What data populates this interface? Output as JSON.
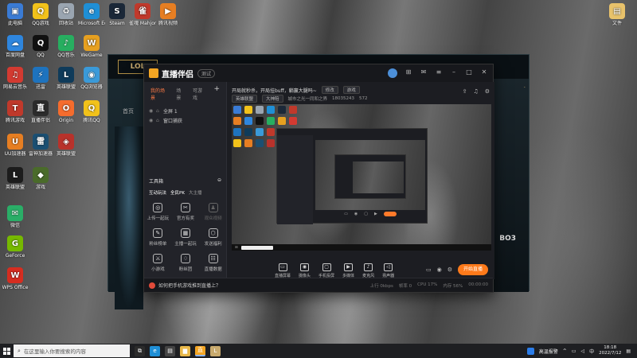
{
  "desktop": {
    "icons": [
      {
        "label": "此电脑",
        "color": "#3a7bd5",
        "glyph": "▣"
      },
      {
        "label": "QQ游戏",
        "color": "#f2c21a",
        "glyph": "Q"
      },
      {
        "label": "回收站",
        "color": "#9aa5b1",
        "glyph": "♻"
      },
      {
        "label": "Microsoft Edge",
        "color": "#1f8fd6",
        "glyph": "e"
      },
      {
        "label": "Steam",
        "color": "#1b2838",
        "glyph": "S"
      },
      {
        "label": "雀魂 Mahjong",
        "color": "#c0392b",
        "glyph": "雀"
      },
      {
        "label": "腾讯视频",
        "color": "#e67e22",
        "glyph": "▶"
      },
      {
        "label": "百度网盘",
        "color": "#2e86de",
        "glyph": "☁"
      },
      {
        "label": "QQ",
        "color": "#111",
        "glyph": "Q"
      },
      {
        "label": "QQ音乐",
        "color": "#27ae60",
        "glyph": "♪"
      },
      {
        "label": "WeGame",
        "color": "#e6a020",
        "glyph": "W"
      },
      {
        "label": "网易云音乐",
        "color": "#d33a31",
        "glyph": "♫"
      },
      {
        "label": "迅雷",
        "color": "#1e73be",
        "glyph": "⚡"
      },
      {
        "label": "英雄联盟",
        "color": "#0f3b5a",
        "glyph": "L"
      },
      {
        "label": "QQ浏览器",
        "color": "#3a9ad9",
        "glyph": "◉"
      },
      {
        "label": "腾讯游戏",
        "color": "#c0392b",
        "glyph": "T"
      },
      {
        "label": "直播伴侣",
        "color": "#2b2b2b",
        "glyph": "直"
      },
      {
        "label": "Origin",
        "color": "#f56c2d",
        "glyph": "O"
      },
      {
        "label": "腾讯QQ",
        "color": "#f2c21a",
        "glyph": "Q"
      },
      {
        "label": "UU加速器",
        "color": "#e67e22",
        "glyph": "U"
      },
      {
        "label": "雷神加速器",
        "color": "#1b4f72",
        "glyph": "雷"
      },
      {
        "label": "英雄联盟",
        "color": "#b8322b",
        "glyph": "◈"
      },
      {
        "label": "英雄联盟",
        "color": "#1c1c1c",
        "glyph": "L"
      },
      {
        "label": "游戏",
        "color": "#4a6b2a",
        "glyph": "◆"
      },
      {
        "label": "微信",
        "color": "#2aae67",
        "glyph": "✉"
      },
      {
        "label": "GeForce",
        "color": "#76b900",
        "glyph": "G"
      },
      {
        "label": "WPS Office",
        "color": "#d62d20",
        "glyph": "W"
      },
      {
        "label": "文件",
        "color": "#e8c26b",
        "glyph": "▤"
      }
    ]
  },
  "game_window": {
    "logo": "LOL",
    "side_label": "首页",
    "right_text": "·",
    "bo3": "BO3"
  },
  "app": {
    "name": "直播伴侣",
    "version": "测试",
    "tabs": [
      "我的场景",
      "场景",
      "可游戏"
    ],
    "scenes": [
      "全屏 1",
      "窗口捕获"
    ],
    "toolbox_title": "工具箱",
    "toolbox_tabs": [
      "互动玩法",
      "全民PK",
      "大主播"
    ],
    "tools": [
      {
        "label": "上传一起玩",
        "icon": "◎",
        "dim": false
      },
      {
        "label": "官方有奖",
        "icon": "✂",
        "dim": false
      },
      {
        "label": "观众视频",
        "icon": "♟",
        "dim": true
      },
      {
        "label": "粉丝榜单",
        "icon": "✎",
        "dim": false
      },
      {
        "label": "主播一起玩",
        "icon": "▦",
        "dim": false
      },
      {
        "label": "发送福利",
        "icon": "⬡",
        "dim": false
      },
      {
        "label": "小游戏",
        "icon": "⚔",
        "dim": false
      },
      {
        "label": "粉丝团",
        "icon": "♢",
        "dim": false
      },
      {
        "label": "直播数据",
        "icon": "☷",
        "dim": false
      }
    ],
    "stream_title": "开局就秒杀，开局挂buff，躺赢大腿吗~",
    "title_chip": "修改",
    "category_chip": "游戏",
    "meta_tag": "英雄联盟",
    "meta_sub": "大神陪",
    "meta_rank": "城市之光一同和之界",
    "meta_id": "18035243",
    "meta_count": "572",
    "bottom_tools": [
      {
        "label": "直播屏幕",
        "icon": "▭"
      },
      {
        "label": "摄像头",
        "icon": "◉"
      },
      {
        "label": "手机投屏",
        "icon": "▢"
      },
      {
        "label": "多媒体",
        "icon": "▶"
      },
      {
        "label": "麦克风",
        "icon": "♪"
      },
      {
        "label": "扬声器",
        "icon": "◁"
      }
    ],
    "start_live": "开始直播",
    "status_tip": "如何把手机游戏推到直播上？",
    "status_items": [
      "上行 0kbps",
      "帧率 0",
      "CPU 17%",
      "内存 56%",
      "00:00:00"
    ]
  },
  "taskbar": {
    "search_placeholder": "在这里输入你要搜索的内容",
    "apps": [
      {
        "name": "task-view",
        "color": "#2b2b2b",
        "glyph": "⧉"
      },
      {
        "name": "edge",
        "color": "#1f8fd6",
        "glyph": "e"
      },
      {
        "name": "store",
        "color": "#444",
        "glyph": "▤"
      },
      {
        "name": "explorer",
        "color": "#e8b84a",
        "glyph": "▆"
      },
      {
        "name": "live",
        "color": "#f5a623",
        "glyph": "直"
      },
      {
        "name": "lol",
        "color": "#c8aa6e",
        "glyph": "L"
      }
    ],
    "tray_label": "高温报警",
    "time": "18:18",
    "date": "2022/7/12"
  }
}
